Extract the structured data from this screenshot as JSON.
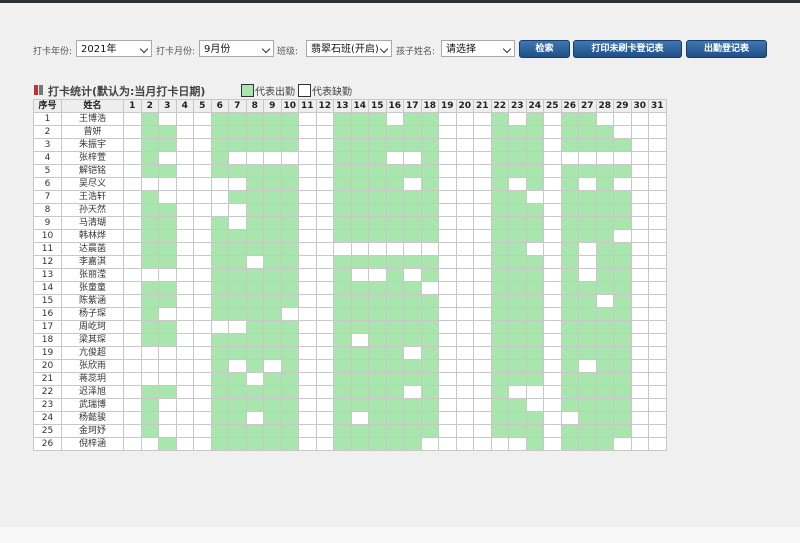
{
  "filters": {
    "year_label": "打卡年份:",
    "year_value": "2021年",
    "month_label": "打卡月份:",
    "month_value": "9月份",
    "class_label": "班级:",
    "class_value": "翡翠石班(开启)",
    "child_label": "孩子姓名:",
    "child_value": "请选择",
    "search_button": "检索",
    "print_button": "打印未刷卡登记表",
    "attendance_button": "出勤登记表"
  },
  "section": {
    "title": "打卡统计(默认为:当月打卡日期)",
    "legend_present": "代表出勤",
    "legend_absent": "代表缺勤"
  },
  "colors": {
    "present": "#a8e6ad",
    "absent": "#ffffff",
    "button": "#1f4f86"
  },
  "table": {
    "header_index": "序号",
    "header_name": "姓名",
    "days": [
      "1",
      "2",
      "3",
      "4",
      "5",
      "6",
      "7",
      "8",
      "9",
      "10",
      "11",
      "12",
      "13",
      "14",
      "15",
      "16",
      "17",
      "18",
      "19",
      "20",
      "21",
      "22",
      "23",
      "24",
      "25",
      "26",
      "27",
      "28",
      "29",
      "30",
      "31"
    ],
    "rows": [
      {
        "no": "1",
        "name": "王博浩",
        "att": "0100011111001110110001010110000"
      },
      {
        "no": "2",
        "name": "曾妍",
        "att": "0110011111001111110001110111000"
      },
      {
        "no": "3",
        "name": "朱振宇",
        "att": "0110011111001111110001110111100"
      },
      {
        "no": "4",
        "name": "张梓萱",
        "att": "0100010000001110010001110000000"
      },
      {
        "no": "5",
        "name": "解铠铭",
        "att": "0110011111001111110001110111100"
      },
      {
        "no": "6",
        "name": "吴尽义",
        "att": "0000000111001111010001010101000"
      },
      {
        "no": "7",
        "name": "王浩轩",
        "att": "0100001111001111110001100111100"
      },
      {
        "no": "8",
        "name": "孙天然",
        "att": "0110000111001111110001110111100"
      },
      {
        "no": "9",
        "name": "马清瑚",
        "att": "0110010111001111110001110111100"
      },
      {
        "no": "10",
        "name": "韩林烨",
        "att": "0110011111001111110001110111000"
      },
      {
        "no": "11",
        "name": "达晨菡",
        "att": "0110011111000000000001100101100"
      },
      {
        "no": "12",
        "name": "李嘉淇",
        "att": "0110011011001111110001110101100"
      },
      {
        "no": "13",
        "name": "张丽滢",
        "att": "0000011111001001010001110101100"
      },
      {
        "no": "14",
        "name": "张童童",
        "att": "0110011111001111100001110111100"
      },
      {
        "no": "15",
        "name": "陈紫涵",
        "att": "0110011111001111110001110110100"
      },
      {
        "no": "16",
        "name": "杨子琛",
        "att": "0100011110001111110001110111100"
      },
      {
        "no": "17",
        "name": "周屹珂",
        "att": "0110000111001111110001110111100"
      },
      {
        "no": "18",
        "name": "梁其琛",
        "att": "0110011111001011110001110111100"
      },
      {
        "no": "19",
        "name": "亢俊超",
        "att": "0000011111001111010001110111100"
      },
      {
        "no": "20",
        "name": "张欣雨",
        "att": "0000010101001111110001110101100"
      },
      {
        "no": "21",
        "name": "蒋蕊玥",
        "att": "0000011011001111110001110111100"
      },
      {
        "no": "22",
        "name": "迟泽旭",
        "att": "0110011111001111010001000111100"
      },
      {
        "no": "23",
        "name": "武瑞博",
        "att": "0100011111001111110001100111100"
      },
      {
        "no": "24",
        "name": "杨懿骏",
        "att": "0100011011001011110001110011100"
      },
      {
        "no": "25",
        "name": "金珂妤",
        "att": "0100011111001111110001110111100"
      },
      {
        "no": "26",
        "name": "倪梓涵",
        "att": "0010011111001111100000010111000"
      }
    ]
  }
}
